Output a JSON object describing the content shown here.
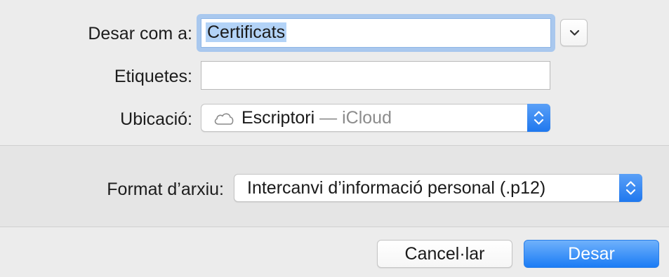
{
  "save_dialog": {
    "save_as": {
      "label": "Desar com a:",
      "value": "Certificats"
    },
    "tags": {
      "label": "Etiquetes:",
      "value": ""
    },
    "location": {
      "label": "Ubicació:",
      "icon": "cloud-icon",
      "folder": "Escriptori",
      "separator": "—",
      "provider": "iCloud"
    },
    "expand_icon": "chevron-down-icon",
    "file_format": {
      "label": "Format d’arxiu:",
      "value": "Intercanvi d’informació personal (.p12)"
    },
    "buttons": {
      "cancel": "Cancel·lar",
      "save": "Desar"
    }
  },
  "colors": {
    "accent": "#1b7cf5",
    "focus_ring": "#a9c8ee",
    "selection": "#b3d3f7",
    "background": "#ececec",
    "accessory_background": "#e5e5e5"
  }
}
